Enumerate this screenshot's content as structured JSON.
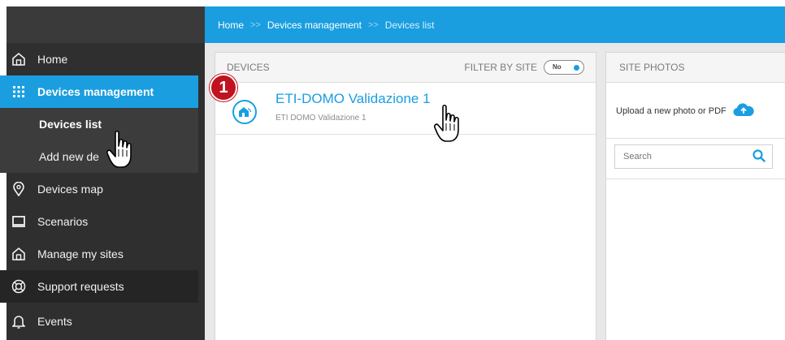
{
  "breadcrumb": {
    "home": "Home",
    "separator": ">>",
    "devices_management": "Devices management",
    "current": "Devices list"
  },
  "sidebar": {
    "items": [
      {
        "label": "Home",
        "icon": "home-icon"
      },
      {
        "label": "Devices management",
        "icon": "grid-icon"
      },
      {
        "label": "Devices list"
      },
      {
        "label": "Add new de"
      },
      {
        "label": "Devices map",
        "icon": "map-pin-icon"
      },
      {
        "label": "Scenarios",
        "icon": "monitor-icon"
      },
      {
        "label": "Manage my sites",
        "icon": "home-icon"
      },
      {
        "label": "Support requests",
        "icon": "lifebuoy-icon"
      },
      {
        "label": "Events",
        "icon": "bell-icon"
      }
    ]
  },
  "devices": {
    "header": "DEVICES",
    "filter_label": "FILTER BY SITE",
    "filter_toggle": "No",
    "list": [
      {
        "name": "ETI-DOMO Validazione 1",
        "site": "ETI DOMO Validazione 1"
      }
    ]
  },
  "annotation": {
    "step": "1"
  },
  "site_photos": {
    "header": "SITE PHOTOS",
    "upload_label": "Upload a new photo or PDF",
    "search_placeholder": "Search"
  },
  "colors": {
    "accent": "#1a9ee0",
    "sidebar_bg": "#2f2f2f",
    "badge": "#c1121f"
  }
}
